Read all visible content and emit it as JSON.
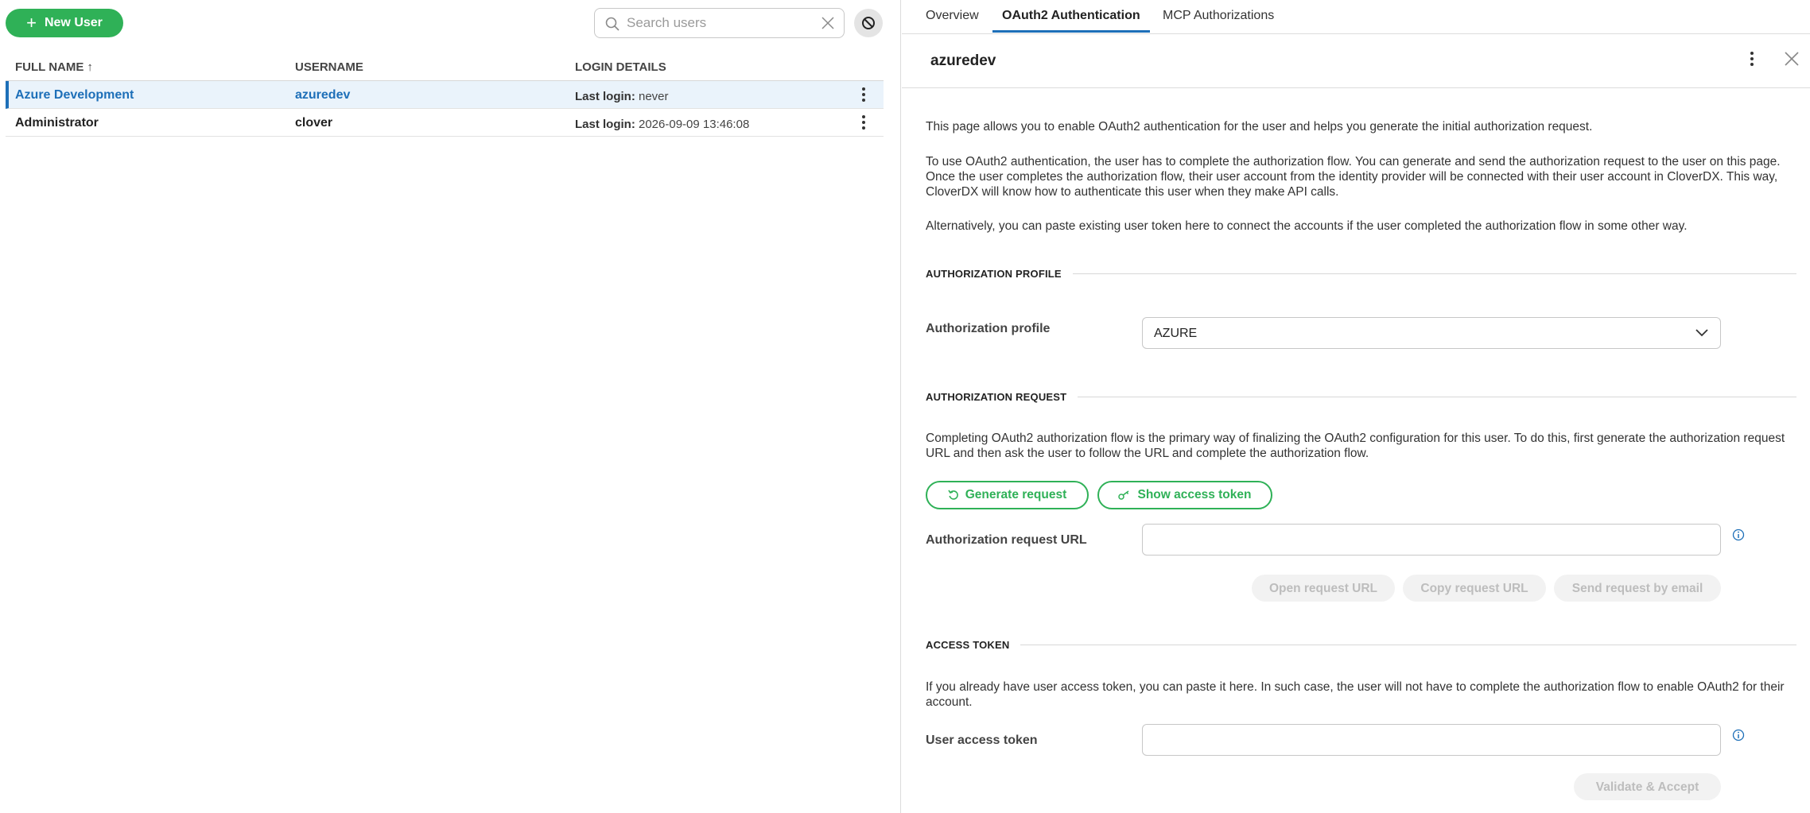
{
  "toolbar": {
    "new_user_label": "New User",
    "search_placeholder": "Search users"
  },
  "users_table": {
    "columns": [
      "FULL NAME",
      "USERNAME",
      "LOGIN DETAILS"
    ],
    "sort_indicator": "↑",
    "rows": [
      {
        "full_name": "Azure Development",
        "username": "azuredev",
        "login_label": "Last login:",
        "login_value": "never",
        "selected": true
      },
      {
        "full_name": "Administrator",
        "username": "clover",
        "login_label": "Last login:",
        "login_value": "2026-09-09 13:46:08",
        "selected": false
      }
    ]
  },
  "detail": {
    "tabs": [
      "Overview",
      "OAuth2 Authentication",
      "MCP Authorizations"
    ],
    "active_tab": "OAuth2 Authentication",
    "title": "azuredev",
    "intro": [
      "This page allows you to enable OAuth2 authentication for the user and helps you generate the initial authorization request.",
      "To use OAuth2 authentication, the user has to complete the authorization flow. You can generate and send the authorization request to the user on this page. Once the user completes the authorization flow, their user account from the identity provider will be connected with their user account in CloverDX. This way, CloverDX will know how to authenticate this user when they make API calls.",
      "Alternatively, you can paste existing user token here to connect the accounts if the user completed the authorization flow in some other way."
    ],
    "auth_profile": {
      "section_title": "AUTHORIZATION PROFILE",
      "label": "Authorization profile",
      "value": "AZURE"
    },
    "auth_request": {
      "section_title": "AUTHORIZATION REQUEST",
      "description": "Completing OAuth2 authorization flow is the primary way of finalizing the OAuth2 configuration for this user. To do this, first generate the authorization request URL and then ask the user to follow the URL and complete the authorization flow.",
      "generate_label": "Generate request",
      "show_token_label": "Show access token",
      "url_label": "Authorization request URL",
      "url_value": "",
      "open_label": "Open request URL",
      "copy_label": "Copy request URL",
      "send_label": "Send request by email"
    },
    "access_token": {
      "section_title": "ACCESS TOKEN",
      "description": "If you already have user access token, you can paste it here. In such case, the user will not have to complete the authorization flow to enable OAuth2 for their account.",
      "label": "User access token",
      "value": "",
      "validate_label": "Validate & Accept"
    }
  },
  "colors": {
    "accent_green": "#2fb157",
    "accent_blue": "#1d6fb8",
    "selected_row_bg": "#eaf3fb"
  },
  "icons": [
    "plus-icon",
    "search-icon",
    "clear-icon",
    "block-filter-icon",
    "kebab-icon",
    "close-icon",
    "chevron-down-icon",
    "refresh-icon",
    "key-icon",
    "info-icon"
  ]
}
